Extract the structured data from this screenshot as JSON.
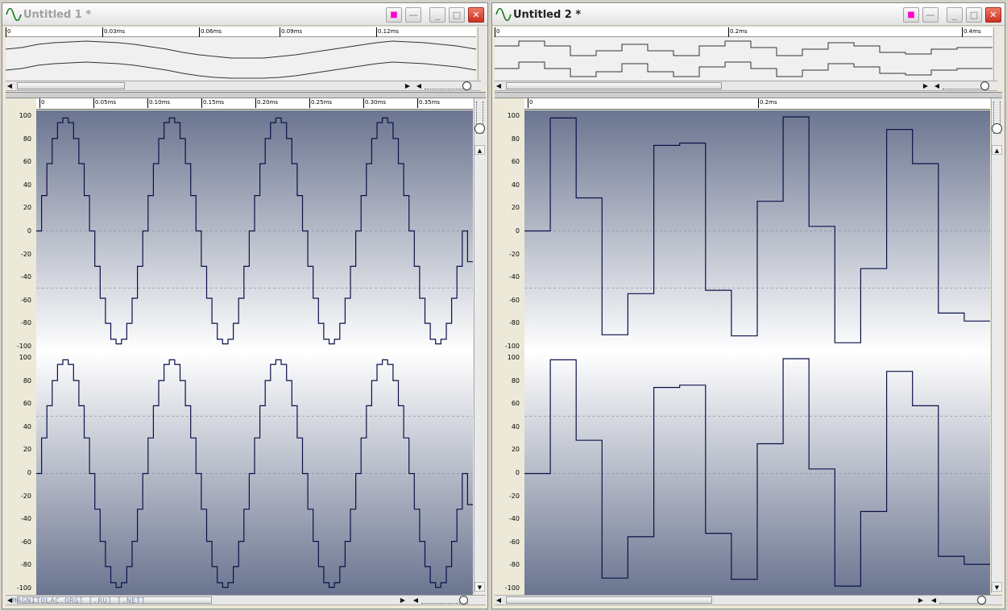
{
  "windows": [
    {
      "title": "Untitled 1 *",
      "overview_ticks": [
        "0",
        "0.03ms",
        "0.06ms",
        "0.09ms",
        "0.12ms"
      ],
      "main_ticks": [
        "0",
        "0.05ms",
        "0.10ms",
        "0.15ms",
        "0.20ms",
        "0.25ms",
        "0.30ms",
        "0.35ms"
      ],
      "y_ticks": [
        "100",
        "80",
        "60",
        "40",
        "20",
        "0",
        "-20",
        "-40",
        "-60",
        "-80",
        "-100"
      ],
      "watermark": "MAGNITOLAC.ORG] [.RU] [.NET]"
    },
    {
      "title": "Untitled 2 *",
      "overview_ticks": [
        "0",
        "0.2ms",
        "0.4ms"
      ],
      "main_ticks": [
        "0",
        "0.2ms"
      ],
      "y_ticks": [
        "100",
        "80",
        "60",
        "40",
        "20",
        "0",
        "-20",
        "-40",
        "-60",
        "-80",
        "-100"
      ]
    }
  ],
  "chart_data": [
    {
      "type": "line",
      "title": "",
      "xlabel": "",
      "ylabel": "",
      "ylim": [
        -100,
        100
      ],
      "xlim_ms": [
        0,
        0.38
      ],
      "step": true,
      "description_series": "stair-stepped sine wave, same on both channels",
      "series": [
        {
          "values": [
            0,
            31,
            59,
            81,
            95,
            99,
            95,
            81,
            59,
            31,
            0,
            -31,
            -59,
            -81,
            -95,
            -99,
            -95,
            -81,
            -59,
            -31,
            0,
            31,
            59,
            81,
            95,
            99,
            95,
            81,
            59,
            31,
            0,
            -31,
            -59,
            -81,
            -95,
            -99,
            -95,
            -81,
            -59,
            -31,
            0,
            31,
            59,
            81,
            95,
            99,
            95,
            81,
            59,
            31,
            0,
            -31,
            -59,
            -81,
            -95,
            -99,
            -95,
            -81,
            -59,
            -31,
            0,
            31,
            59,
            81,
            95,
            99,
            95,
            81,
            59,
            31,
            0,
            -31,
            -59,
            -81,
            -95,
            -99,
            -95,
            -81,
            -59,
            -31,
            0,
            -27
          ]
        }
      ]
    },
    {
      "type": "line",
      "title": "",
      "xlabel": "",
      "ylabel": "",
      "ylim": [
        -100,
        100
      ],
      "xlim_ms": [
        0,
        0.4
      ],
      "step": true,
      "series": [
        {
          "values": [
            0,
            99,
            29,
            -91,
            -55,
            75,
            77,
            -52,
            -92,
            26,
            100,
            4,
            -98,
            -33,
            89,
            59,
            -72,
            -79
          ]
        }
      ]
    }
  ],
  "colors": {
    "waveform": "#0b1148",
    "plot_dark": "#6b7590",
    "plot_light": "#ffffff",
    "record_button": "#ff00cc",
    "close_button": "#d2402d"
  },
  "icons": {
    "app": "sine-wave-icon",
    "record": "record-icon",
    "minimize": "minimize-icon",
    "maximize": "maximize-icon",
    "close": "close-icon"
  }
}
